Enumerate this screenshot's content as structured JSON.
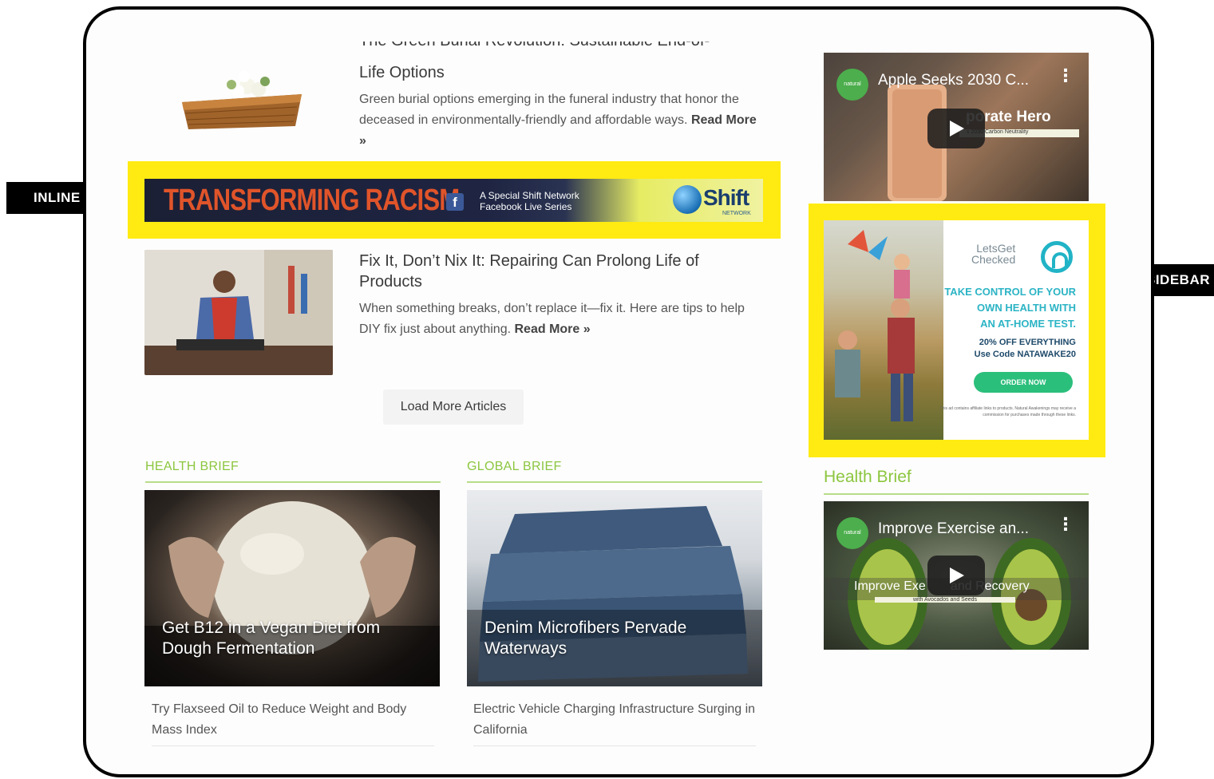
{
  "callouts": {
    "inline": "INLINE",
    "sidebar": "SIDEBAR"
  },
  "article_partial": {
    "title_cut": "The Green Burial Revolution: Sustainable End-of-",
    "title_rest": "Life Options",
    "desc": "Green burial options emerging in the funeral industry that honor the deceased in environmentally-friendly and affordable ways.",
    "read_more": "Read More »"
  },
  "inline_ad": {
    "headline": "TRANSFORMING RACISM",
    "fb": "f",
    "line1": "A Special Shift Network",
    "line2": "Facebook Live Series",
    "brand": "Shift",
    "brand_sub": "NETWORK"
  },
  "article2": {
    "title": "Fix It, Don’t Nix It: Repairing Can Prolong Life of Products",
    "desc": "When something breaks, don’t replace it—fix it. Here are tips to help DIY fix just about anything.",
    "read_more": "Read More »"
  },
  "load_more": "Load More Articles",
  "health_brief": {
    "label": "HEALTH BRIEF",
    "card_title": "Get B12 in a Vegan Diet from Dough Fermentation",
    "caption": "Try Flaxseed Oil to Reduce Weight and Body Mass Index"
  },
  "global_brief": {
    "label": "GLOBAL BRIEF",
    "card_title": "Denim Microfibers Pervade Waterways",
    "caption": "Electric Vehicle Charging Infrastructure Surging in California"
  },
  "sidebar": {
    "video1": {
      "badge": "natural",
      "title": "Apple Seeks 2030 C...",
      "overlay": "porate Hero",
      "overlay_sub": "s 2030 Carbon Neutrality"
    },
    "ad": {
      "brand_line1": "LetsGet",
      "brand_line2": "Checked",
      "headline_1": "TAKE CONTROL OF YOUR",
      "headline_2": "OWN HEALTH WITH",
      "headline_3": "AN AT-HOME TEST.",
      "offer_1": "20% OFF EVERYTHING",
      "offer_2": "Use Code NATAWAKE20",
      "cta": "ORDER NOW",
      "fine_print": "This ad contains affiliate links to products. Natural Awakenings may receive a commission for purchases made through these links."
    },
    "heading": "Health Brief",
    "video2": {
      "badge": "natural",
      "title": "Improve Exercise an...",
      "overlay": "Improve Exe       and Recovery",
      "overlay_sub": "with Avocados and Seeds"
    }
  },
  "colors": {
    "highlight": "#ffeb12",
    "brief_green": "#8cc63f",
    "ad_teal": "#2cb4c5",
    "cta_green": "#2bbf7c"
  }
}
